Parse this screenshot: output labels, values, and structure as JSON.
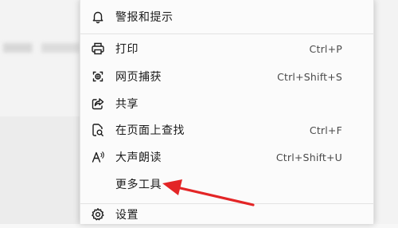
{
  "menu": {
    "alerts": {
      "label": "警报和提示",
      "icon": "bell-icon"
    },
    "print": {
      "label": "打印",
      "shortcut": "Ctrl+P",
      "icon": "printer-icon"
    },
    "web_capture": {
      "label": "网页捕获",
      "shortcut": "Ctrl+Shift+S",
      "icon": "web-capture-icon"
    },
    "share": {
      "label": "共享",
      "icon": "share-icon"
    },
    "find": {
      "label": "在页面上查找",
      "shortcut": "Ctrl+F",
      "icon": "find-in-page-icon"
    },
    "read_aloud": {
      "label": "大声朗读",
      "shortcut": "Ctrl+Shift+U",
      "icon": "read-aloud-icon"
    },
    "more_tools": {
      "label": "更多工具"
    },
    "settings": {
      "label": "设置",
      "icon": "gear-icon"
    }
  },
  "colors": {
    "annotation_arrow": "#e32526"
  }
}
